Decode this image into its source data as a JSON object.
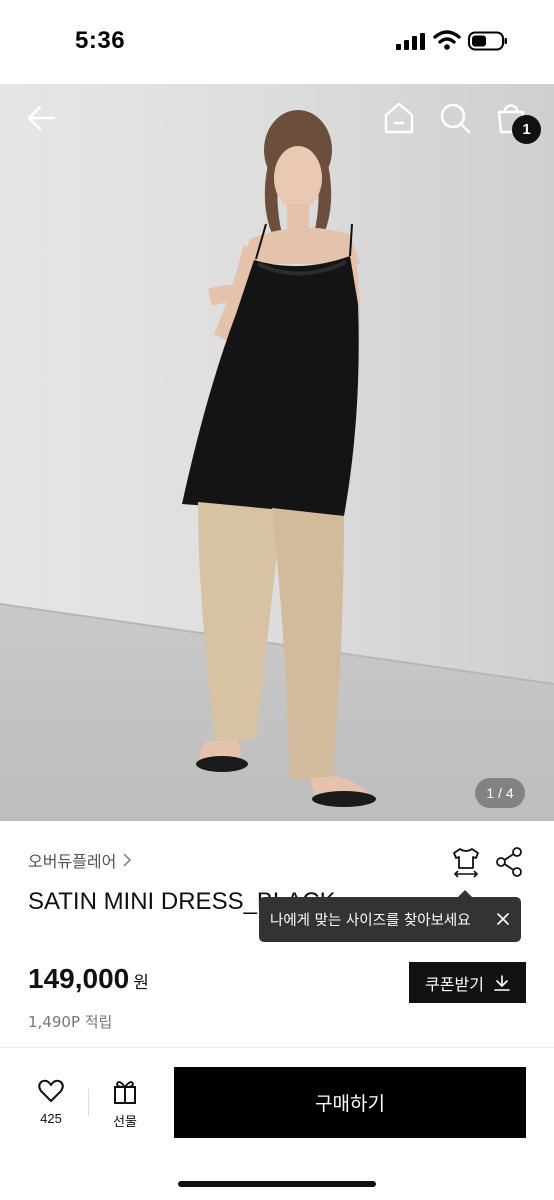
{
  "status_bar": {
    "time": "5:36"
  },
  "hero": {
    "pager": "1 / 4",
    "cart_count": "1"
  },
  "product": {
    "brand": "오버듀플레어",
    "name": "SATIN MINI DRESS_BLACK",
    "price": "149,000",
    "price_unit": "원",
    "points": "1,490P 적립"
  },
  "tooltip": {
    "text": "나에게 맞는 사이즈를 찾아보세요"
  },
  "coupon": {
    "label": "쿠폰받기"
  },
  "bottom_bar": {
    "like_count": "425",
    "gift_label": "선물",
    "buy_label": "구매하기"
  },
  "icons": [
    "back-arrow-icon",
    "home-icon",
    "search-icon",
    "shopping-bag-icon",
    "chevron-right-icon",
    "size-guide-icon",
    "share-icon",
    "close-icon",
    "download-icon",
    "heart-icon",
    "gift-icon"
  ],
  "colors": {
    "primary": "#000000",
    "tooltip_bg": "#333333",
    "text_muted": "#777777"
  }
}
